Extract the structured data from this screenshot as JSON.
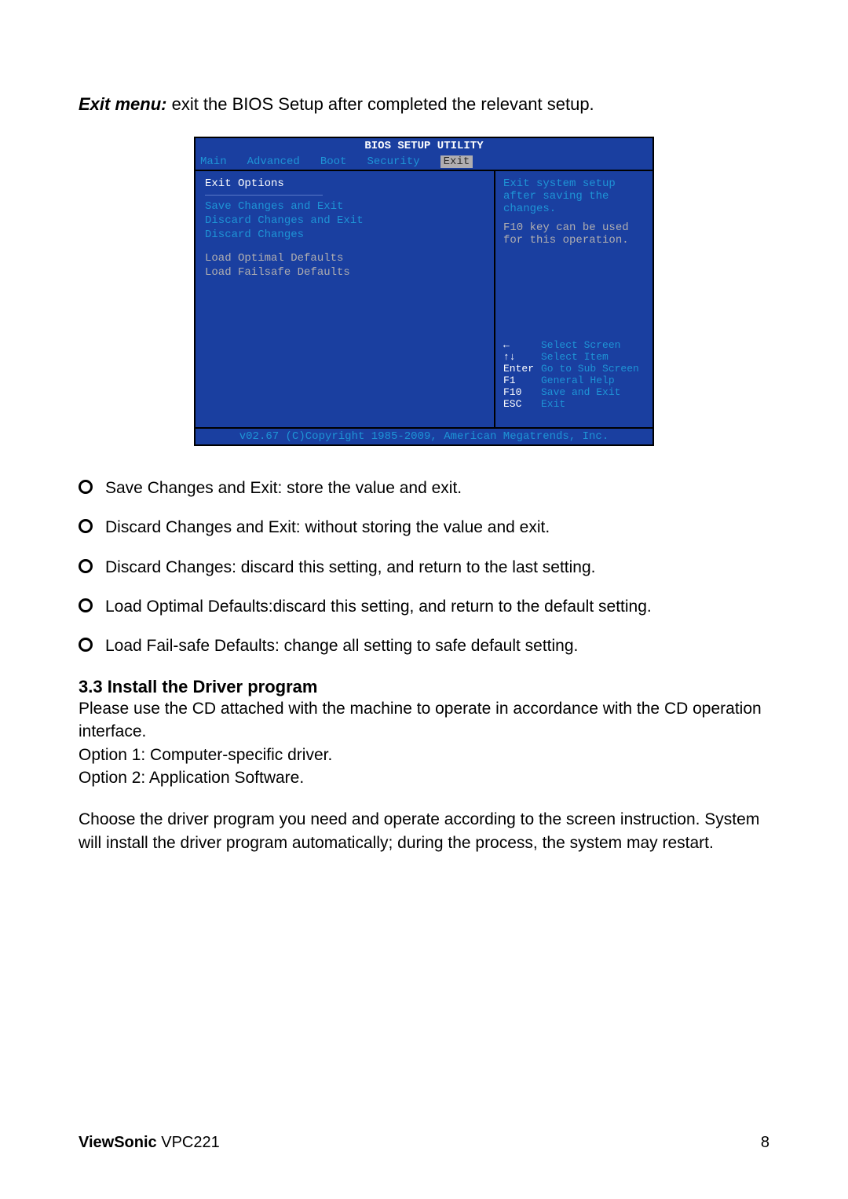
{
  "intro": {
    "bold": "Exit menu:",
    "rest": " exit the BIOS Setup after completed the relevant setup."
  },
  "bios": {
    "title": "BIOS SETUP UTILITY",
    "tabs": [
      "Main",
      "Advanced",
      "Boot",
      "Security",
      "Exit"
    ],
    "section_title": "Exit Options",
    "items_blue": [
      "Save Changes and Exit",
      "Discard Changes and Exit",
      "Discard Changes"
    ],
    "items_gray": [
      "Load Optimal Defaults",
      "Load Failsafe Defaults"
    ],
    "help_main": "Exit system setup after saving the changes.",
    "help_sub": "F10 key can be used for this operation.",
    "nav": [
      {
        "key": "←",
        "act": "Select Screen"
      },
      {
        "key": "↑↓",
        "act": "Select Item"
      },
      {
        "key": "Enter",
        "act": "Go to Sub Screen"
      },
      {
        "key": "F1",
        "act": "General Help"
      },
      {
        "key": "F10",
        "act": "Save and Exit"
      },
      {
        "key": "ESC",
        "act": "Exit"
      }
    ],
    "footer": "v02.67 (C)Copyright 1985-2009, American Megatrends, Inc."
  },
  "bullets": [
    "Save Changes and Exit: store the value and exit.",
    "Discard Changes and Exit: without storing the value and exit.",
    "Discard Changes: discard this setting, and return to the last setting.",
    "Load Optimal Defaults:discard this setting, and return to the default setting.",
    "Load Fail-safe Defaults: change all setting to safe default setting."
  ],
  "section33": {
    "heading": "3.3 Install the Driver program",
    "p1": "Please use the CD attached with the machine to operate in accordance with the CD operation interface.",
    "opt1": "Option 1: Computer-specific driver.",
    "opt2": "Option 2: Application Software.",
    "p2": "Choose the driver program you need and operate according to the screen instruction. System will install the driver program automatically; during the process, the system may restart."
  },
  "footer": {
    "brand_bold": "ViewSonic",
    "brand_model": "  VPC221",
    "page": "8"
  }
}
